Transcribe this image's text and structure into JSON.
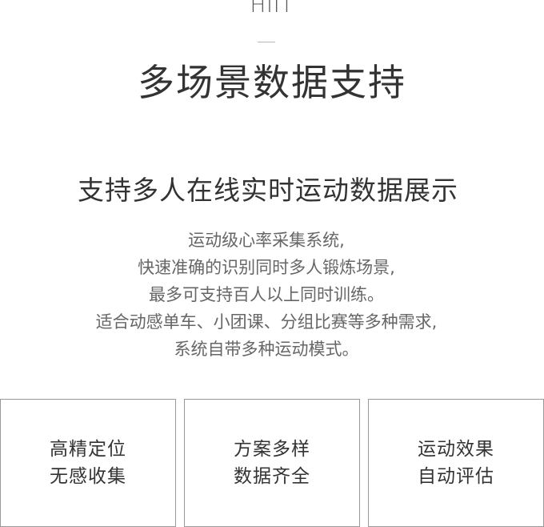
{
  "header": {
    "eyebrow": "HIIT",
    "title": "多场景数据支持"
  },
  "feature": {
    "subtitle": "支持多人在线实时运动数据展示",
    "description_lines": [
      "运动级心率采集系统,",
      "快速准确的识别同时多人锻炼场景,",
      "最多可支持百人以上同时训练。",
      "适合动感单车、小团课、分组比赛等多种需求,",
      "系统自带多种运动模式。"
    ]
  },
  "cards": [
    {
      "line1": "高精定位",
      "line2": "无感收集"
    },
    {
      "line1": "方案多样",
      "line2": "数据齐全"
    },
    {
      "line1": "运动效果",
      "line2": "自动评估"
    }
  ]
}
